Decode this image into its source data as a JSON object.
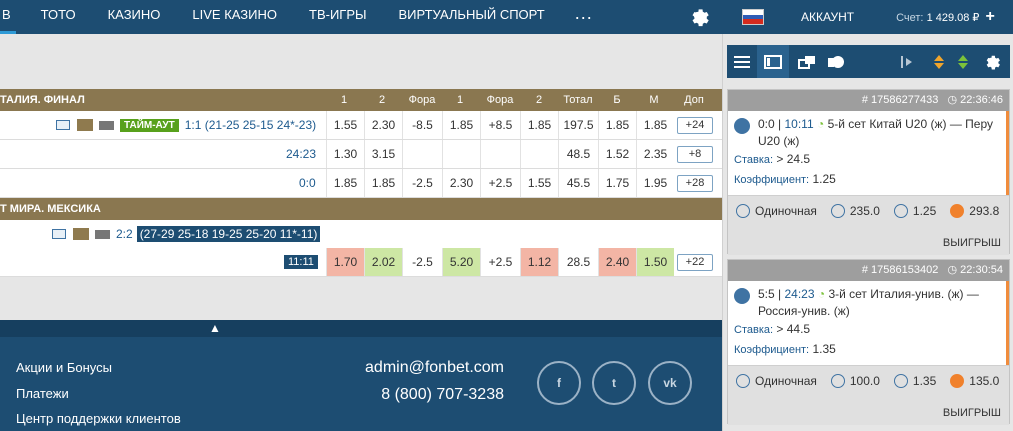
{
  "nav": {
    "active_label": "В",
    "items": [
      "ТОТО",
      "КАЗИНО",
      "LIVE КАЗИНО",
      "ТВ-ИГРЫ",
      "ВИРТУАЛЬНЫЙ СПОРТ"
    ],
    "more": "..."
  },
  "account": {
    "label": "АККАУНТ",
    "balance_label": "Счет:",
    "balance": "1 429.08 ₽",
    "add": "+"
  },
  "columns": [
    "1",
    "2",
    "Фора",
    "1",
    "Фора",
    "2",
    "Тотал",
    "Б",
    "М",
    "Доп"
  ],
  "events": [
    {
      "title": "ТАЛИЯ. ФИНАЛ",
      "rows": [
        {
          "tag": "ТАЙМ-АУТ",
          "score": "1:1 (21-25 25-15 24*-23)",
          "odds": [
            "1.55",
            "2.30",
            "-8.5",
            "1.85",
            "+8.5",
            "1.85",
            "197.5",
            "1.85",
            "1.85"
          ],
          "dop": "+24"
        },
        {
          "score": "24:23",
          "odds": [
            "1.30",
            "3.15",
            "",
            "",
            "",
            "",
            "48.5",
            "1.52",
            "2.35"
          ],
          "dop": "+8"
        },
        {
          "score": "0:0",
          "odds": [
            "1.85",
            "1.85",
            "-2.5",
            "2.30",
            "+2.5",
            "1.55",
            "45.5",
            "1.75",
            "1.95"
          ],
          "dop": "+28"
        }
      ]
    },
    {
      "title": "Т МИРА. МЕКСИКА",
      "rows": [
        {
          "score": "2:2",
          "sets": "(27-29 25-18 19-25 25-20 11*-11)"
        },
        {
          "score": "11:11",
          "odds": [
            "1.70",
            "2.02",
            "-2.5",
            "5.20",
            "+2.5",
            "1.12",
            "28.5",
            "2.40",
            "1.50"
          ],
          "dop": "+22"
        }
      ]
    }
  ],
  "footer": {
    "links": [
      "Акции и Бонусы",
      "Платежи",
      "Центр поддержки клиентов"
    ],
    "email": "admin@fonbet.com",
    "phone": "8 (800) 707-3238",
    "social": [
      "f",
      "t",
      "vk"
    ]
  },
  "bets": [
    {
      "id": "# 17586277433",
      "time": "22:36:46",
      "score": "0:0",
      "clock": "10:11",
      "desc": "5-й сет Китай U20 (ж) — Перу U20 (ж)",
      "stake_label": "Ставка:",
      "stake": "> 24.5",
      "coef_label": "Коэффициент:",
      "coef": "1.25",
      "type": "Одиночная",
      "amount": "235.0",
      "coef2": "1.25",
      "payout": "293.8",
      "result": "ВЫИГРЫШ"
    },
    {
      "id": "# 17586153402",
      "time": "22:30:54",
      "score": "5:5",
      "clock": "24:23",
      "desc": "3-й сет Италия-унив. (ж) — Россия-унив. (ж)",
      "stake_label": "Ставка:",
      "stake": "> 44.5",
      "coef_label": "Коэффициент:",
      "coef": "1.35",
      "type": "Одиночная",
      "amount": "100.0",
      "coef2": "1.35",
      "payout": "135.0",
      "result": "ВЫИГРЫШ"
    }
  ],
  "colors": {
    "nav_bg": "#1d4d72",
    "header_bg": "#8a7750",
    "odds_red": "#f3b5a5",
    "odds_green": "#cde7a4",
    "accent_orange": "#f08c3c"
  }
}
